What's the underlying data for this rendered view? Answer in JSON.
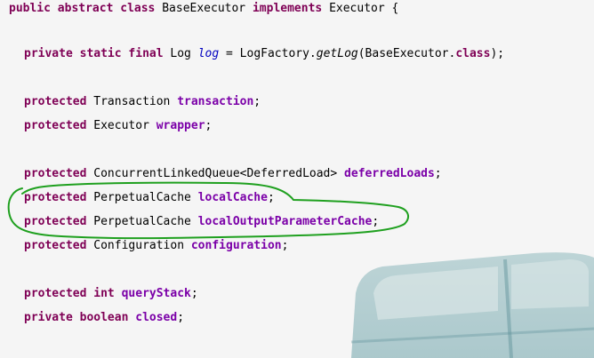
{
  "colors": {
    "keyword": "#7f0055",
    "field": "#7b00a8",
    "static_field": "#0000c0",
    "text": "#000000",
    "annotation": "#1fa01f"
  },
  "background_image": "teal-vintage-car",
  "annotation": {
    "shape": "green-hand-drawn-ellipse",
    "encloses": [
      "localCache",
      "localOutputParameterCache"
    ]
  },
  "code": {
    "l1": {
      "kw1": "public",
      "kw2": "abstract",
      "kw3": "class",
      "name": " BaseExecutor ",
      "kw4": "implements",
      "tail": " Executor {"
    },
    "l2": {
      "kw1": "private",
      "kw2": "static",
      "kw3": "final",
      "type": " Log ",
      "field": "log",
      "eq": " = LogFactory.",
      "method": "getLog",
      "arg": "(BaseExecutor.",
      "kw4": "class",
      "tail": ");"
    },
    "l3": {
      "kw": "protected",
      "type": " Transaction ",
      "field": "transaction",
      "tail": ";"
    },
    "l4": {
      "kw": "protected",
      "type": " Executor ",
      "field": "wrapper",
      "tail": ";"
    },
    "l5": {
      "kw": "protected",
      "type": " ConcurrentLinkedQueue<DeferredLoad> ",
      "field": "deferredLoads",
      "tail": ";"
    },
    "l6": {
      "kw": "protected",
      "type": " PerpetualCache ",
      "field": "localCache",
      "tail": ";"
    },
    "l7": {
      "kw": "protected",
      "type": " PerpetualCache ",
      "field": "localOutputParameterCache",
      "tail": ";"
    },
    "l8": {
      "kw": "protected",
      "type": " Configuration ",
      "field": "configuration",
      "tail": ";"
    },
    "l9": {
      "kw1": "protected",
      "kw2": "int",
      "field": "queryStack",
      "tail": ";"
    },
    "l10": {
      "kw1": "private",
      "kw2": "boolean",
      "field": "closed",
      "tail": ";"
    }
  }
}
